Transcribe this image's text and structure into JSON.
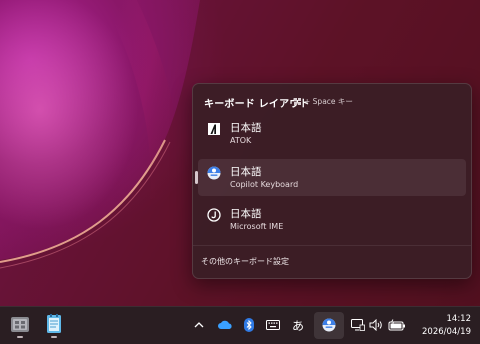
{
  "flyout": {
    "title": "キーボード レイアウト",
    "shortcut_hint": "+ Space キー",
    "items": [
      {
        "name": "日本語",
        "sub": "ATOK",
        "icon": "atok-icon",
        "selected": false
      },
      {
        "name": "日本語",
        "sub": "Copilot Keyboard",
        "icon": "copilot-keyboard-icon",
        "selected": true
      },
      {
        "name": "日本語",
        "sub": "Microsoft IME",
        "icon": "microsoft-ime-icon",
        "selected": false
      }
    ],
    "footer_link": "その他のキーボード設定"
  },
  "taskbar": {
    "apps": [
      {
        "name": "file-manager-app-icon"
      },
      {
        "name": "notepad-app-icon"
      }
    ],
    "tray": {
      "chevron": "^",
      "ime_mode": "あ",
      "icons": [
        "chevron-up-icon",
        "onedrive-cloud-icon",
        "bluetooth-icon",
        "touch-keyboard-icon",
        "ime-mode-indicator",
        "copilot-keyboard-icon",
        "network-icon",
        "volume-icon",
        "battery-icon"
      ]
    },
    "clock": {
      "time": "14:12",
      "date": "2026/04/19"
    }
  },
  "colors": {
    "accent": "#4a8ef0",
    "flyout_bg": "#3a1e26",
    "taskbar_bg": "#2a1e22"
  }
}
